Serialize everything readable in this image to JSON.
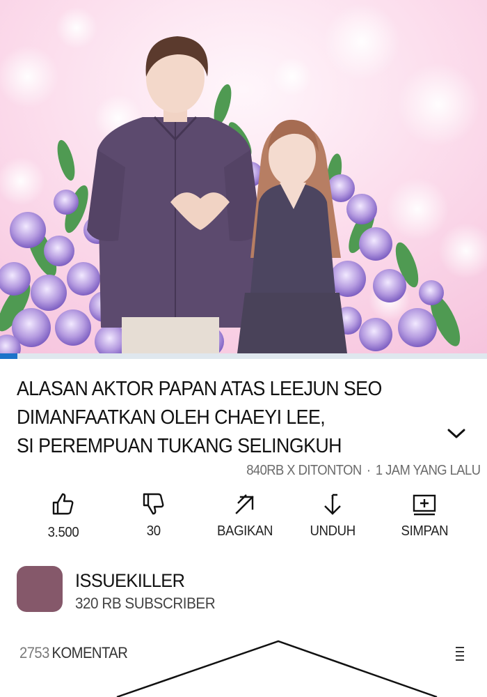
{
  "video": {
    "thumbnail_icon": "couple-illustration-thumbnail",
    "progress_fraction": 0.035,
    "accent_color": "#1b73c9"
  },
  "title": {
    "lines": [
      "ALASAN AKTOR PAPAN ATAS LEEJUN SEO",
      "DIMANFAATKAN OLEH CHAEYI LEE,",
      "SI PEREMPUAN TUKANG SELINGKUH"
    ],
    "expand_icon": "chevron-down-icon"
  },
  "meta": {
    "views": "840RB X DITONTON",
    "separator": "·",
    "time": "1 JAM YANG LALU"
  },
  "actions": [
    {
      "icon": "thumbs-up-icon",
      "label": "3.500"
    },
    {
      "icon": "thumbs-down-icon",
      "label": "30"
    },
    {
      "icon": "share-arrow-icon",
      "label": "BAGIKAN"
    },
    {
      "icon": "download-icon",
      "label": "UNDUH"
    },
    {
      "icon": "save-playlist-icon",
      "label": "SIMPAN"
    }
  ],
  "channel": {
    "name": "ISSUEKILLER",
    "subscribers": "320 RB SUBSCRIBER",
    "avatar_color": "#85586a"
  },
  "comments": {
    "count": "2753",
    "label": "KOMENTAR",
    "sort_icon": "sort-menu-icon"
  }
}
